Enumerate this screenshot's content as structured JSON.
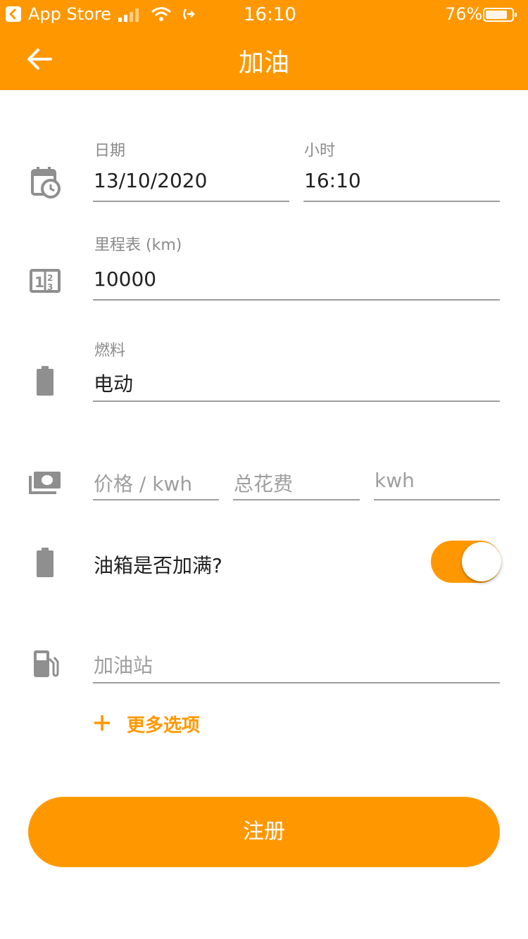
{
  "status_bar": {
    "back_app_label": "App Store",
    "time": "16:10",
    "battery_percent": "76%"
  },
  "header": {
    "title": "加油"
  },
  "form": {
    "date": {
      "label": "日期",
      "value": "13/10/2020"
    },
    "hour": {
      "label": "小时",
      "value": "16:10"
    },
    "odometer": {
      "label": "里程表 (km)",
      "value": "10000"
    },
    "fuel": {
      "label": "燃料",
      "value": "电动"
    },
    "price_per_kwh": {
      "placeholder": "价格 / kwh"
    },
    "total_cost": {
      "placeholder": "总花费"
    },
    "kwh": {
      "placeholder": "kwh"
    },
    "full_tank": {
      "label": "油箱是否加满?",
      "checked": true
    },
    "station": {
      "placeholder": "加油站"
    },
    "more_options_label": "更多选项"
  },
  "submit_label": "注册",
  "colors": {
    "accent": "#FF9800",
    "icon_gray": "#8f8f8f",
    "line_gray": "#9e9e9e"
  },
  "icons": [
    "back-arrow-icon",
    "calendar-clock-icon",
    "odometer-icon",
    "battery-icon",
    "money-icon",
    "fuel-pump-icon",
    "plus-icon"
  ]
}
